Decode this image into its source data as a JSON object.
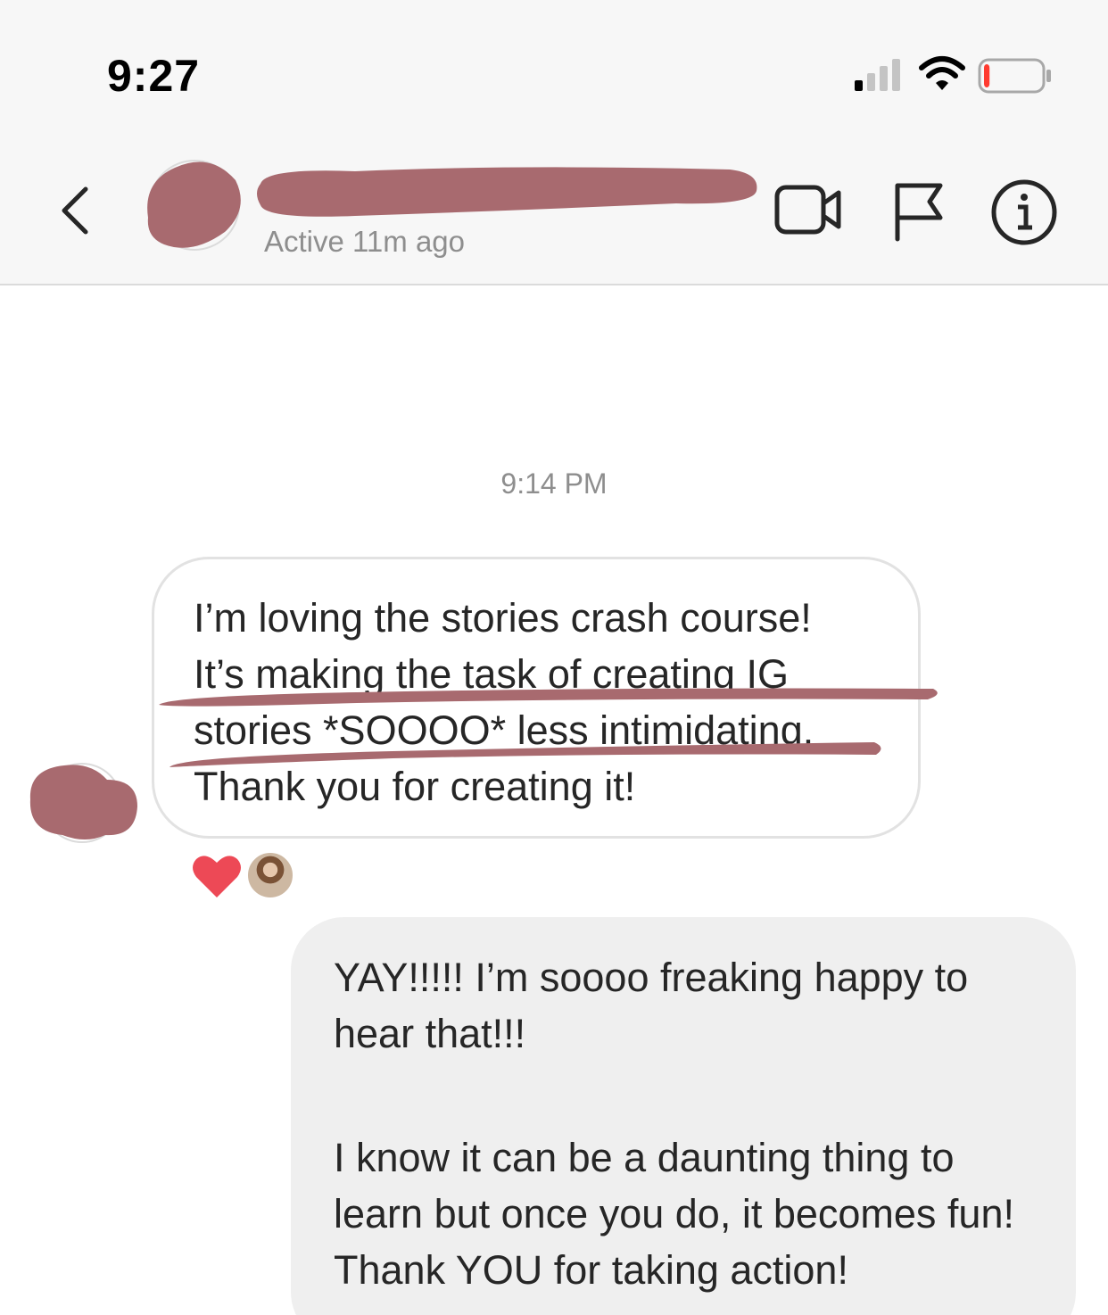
{
  "status_bar": {
    "time": "9:27",
    "signal_icon": "cellular-signal-icon",
    "wifi_icon": "wifi-icon",
    "battery_icon": "battery-low-icon",
    "battery_level": 0.1,
    "battery_color": "#ff3b30"
  },
  "header": {
    "back_icon": "chevron-left-icon",
    "active_status": "Active 11m ago",
    "video_icon": "video-camera-icon",
    "flag_icon": "flag-icon",
    "info_icon": "info-icon",
    "redaction_color": "#a86a6f"
  },
  "thread": {
    "timestamp": "9:14 PM",
    "received_message": "I’m loving the stories crash course!\nIt’s making the task of creating IG\nstories *SOOOO* less intimidating.\nThank you for creating it!",
    "reactions": {
      "heart_icon": "heart-icon",
      "heart_color": "#ed4956"
    },
    "sent_message": {
      "paragraph_1": "YAY!!!!! I’m soooo freaking happy to hear that!!!",
      "paragraph_2": "I know it can be a daunting thing to learn but once you do, it becomes fun! Thank YOU for taking action!"
    }
  }
}
